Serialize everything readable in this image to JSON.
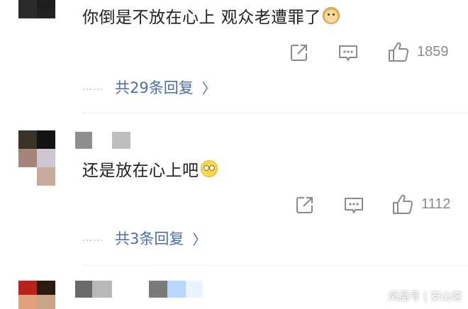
{
  "comments": [
    {
      "text": "你倒是不放在心上 观众老遭罪了",
      "emoji_icon": "doge-emoji-icon",
      "likes": "1859",
      "replies_label": "共29条回复"
    },
    {
      "text": "还是放在心上吧",
      "emoji_icon": "eye-roll-emoji-icon",
      "likes": "1112",
      "replies_label": "共3条回复"
    }
  ],
  "dots": "……",
  "chevron": "〉",
  "watermark": "凤凰号 | 安山客",
  "colors": {
    "reply_link": "#4a6ea8",
    "action_icon": "#8a8a8a",
    "text": "#1f1f1f"
  }
}
